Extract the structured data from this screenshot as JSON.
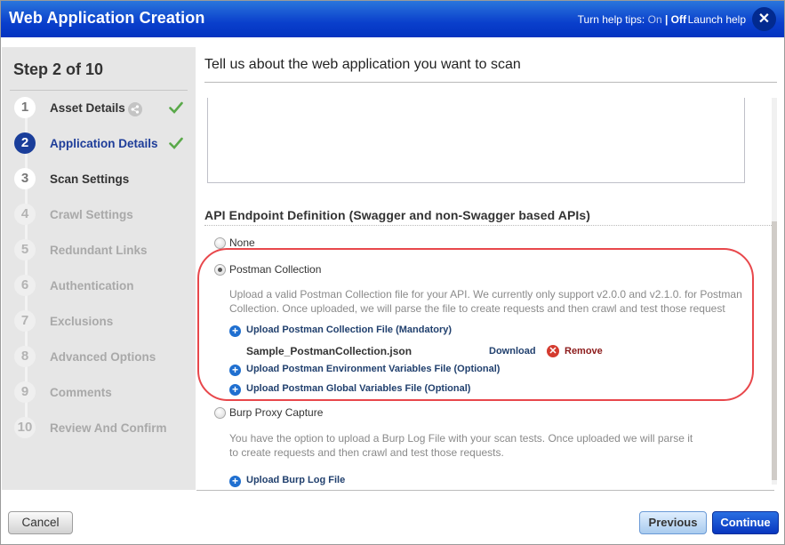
{
  "window": {
    "title": "Web Application Creation",
    "help_tips_prefix": "Turn help tips:",
    "help_tips_on": "On",
    "help_tips_sep": "|",
    "help_tips_off": "Off",
    "launch_help": "Launch help",
    "close_glyph": "✕"
  },
  "sidebar": {
    "step_title": "Step 2 of 10",
    "steps": [
      {
        "num": "1",
        "label": "Asset Details",
        "state": "complete",
        "shared": true,
        "checked": true
      },
      {
        "num": "2",
        "label": "Application Details",
        "state": "current",
        "checked": true
      },
      {
        "num": "3",
        "label": "Scan Settings",
        "state": "available"
      },
      {
        "num": "4",
        "label": "Crawl Settings",
        "state": "disabled"
      },
      {
        "num": "5",
        "label": "Redundant Links",
        "state": "disabled"
      },
      {
        "num": "6",
        "label": "Authentication",
        "state": "disabled"
      },
      {
        "num": "7",
        "label": "Exclusions",
        "state": "disabled"
      },
      {
        "num": "8",
        "label": "Advanced Options",
        "state": "disabled"
      },
      {
        "num": "9",
        "label": "Comments",
        "state": "disabled"
      },
      {
        "num": "10",
        "label": "Review And Confirm",
        "state": "disabled"
      }
    ]
  },
  "main": {
    "heading": "Tell us about the web application you want to scan",
    "textbox_value": "",
    "api_section": {
      "title": "API Endpoint Definition (Swagger and non-Swagger based APIs)",
      "options": [
        {
          "label": "None",
          "selected": false
        },
        {
          "label": "Postman Collection",
          "selected": true
        },
        {
          "label": "Burp Proxy Capture",
          "selected": false
        }
      ],
      "postman": {
        "description_line1": "Upload a valid Postman Collection file for your API. We currently only support v2.0.0 and v2.1.0. for Postman",
        "description_line2": "Collection. Once uploaded, we will parse the file to create requests and then crawl and test those request",
        "upload_collection": "Upload Postman Collection File (Mandatory)",
        "file_name": "Sample_PostmanCollection.json",
        "download": "Download",
        "remove": "Remove",
        "upload_env": "Upload Postman Environment Variables File (Optional)",
        "upload_global": "Upload Postman Global Variables File (Optional)"
      },
      "burp": {
        "description_line1": "You have the option to upload a Burp Log File with your scan tests. Once uploaded we will parse it",
        "description_line2": "to create requests and then crawl and test those requests.",
        "upload": "Upload Burp Log File"
      }
    }
  },
  "footer": {
    "cancel": "Cancel",
    "previous": "Previous",
    "continue": "Continue"
  },
  "icons": {
    "plus": "+",
    "remove": "✕"
  },
  "colors": {
    "title_bar": "#0a3fcc",
    "current_step": "#1a3e9a",
    "link": "#21406e",
    "remove": "#8c1a1a",
    "highlight": "#e8474b",
    "check": "#5aa94a"
  }
}
